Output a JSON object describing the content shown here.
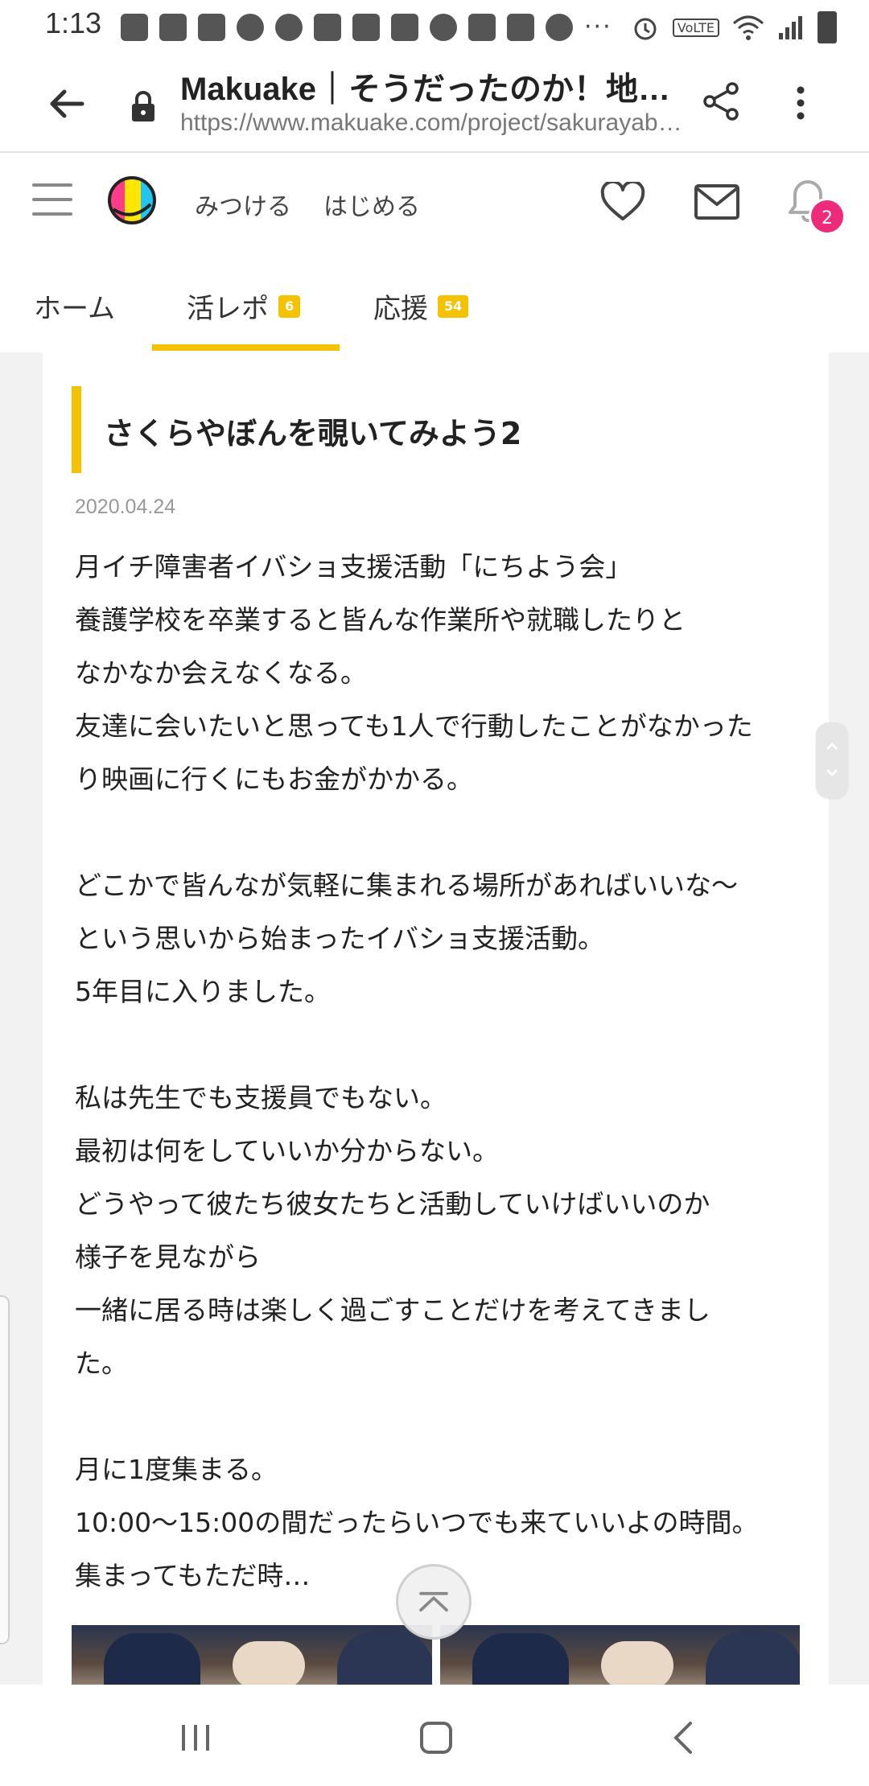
{
  "status_bar": {
    "time": "1:13",
    "icons": [
      "youtube-icon",
      "gallery-icon",
      "gallery-icon",
      "app-icon",
      "instagram-icon",
      "jimoty-icon",
      "jimoty-icon",
      "yahoo-icon",
      "app-icon",
      "d-app-icon",
      "clock-icon",
      "alert-icon"
    ],
    "overflow": "···",
    "volte": "VoLTE"
  },
  "browser": {
    "title": "Makuake｜そうだったのか！地…",
    "url": "https://www.makuake.com/project/sakurayab…"
  },
  "site_header": {
    "nav": {
      "find": "みつける",
      "start": "はじめる"
    },
    "notification_count": "2"
  },
  "tabs": [
    {
      "label": "ホーム",
      "count": ""
    },
    {
      "label": "活レポ",
      "count": "6"
    },
    {
      "label": "応援",
      "count": "54"
    }
  ],
  "post": {
    "title": "さくらやぼんを覗いてみよう2",
    "date": "2020.04.24",
    "lines": [
      "月イチ障害者イバショ支援活動「にちよう会」",
      "養護学校を卒業すると皆んな作業所や就職したりと",
      "なかなか会えなくなる。",
      "友達に会いたいと思っても1人で行動したことがなかった",
      "り映画に行くにもお金がかかる。",
      "",
      "どこかで皆んなが気軽に集まれる場所があればいいな～",
      "という思いから始まったイバショ支援活動。",
      "5年目に入りました。",
      "",
      "私は先生でも支援員でもない。",
      "最初は何をしていいか分からない。",
      "どうやって彼たち彼女たちと活動していけばいいのか",
      "様子を見ながら",
      "一緒に居る時は楽しく過ごすことだけを考えてきまし",
      "た。",
      "",
      "月に1度集まる。",
      "10:00～15:00の間だったらいつでも来ていいよの時間。",
      "集まってもただ時…"
    ]
  },
  "colors": {
    "accent": "#f4c200",
    "badge": "#ee2a7b"
  }
}
